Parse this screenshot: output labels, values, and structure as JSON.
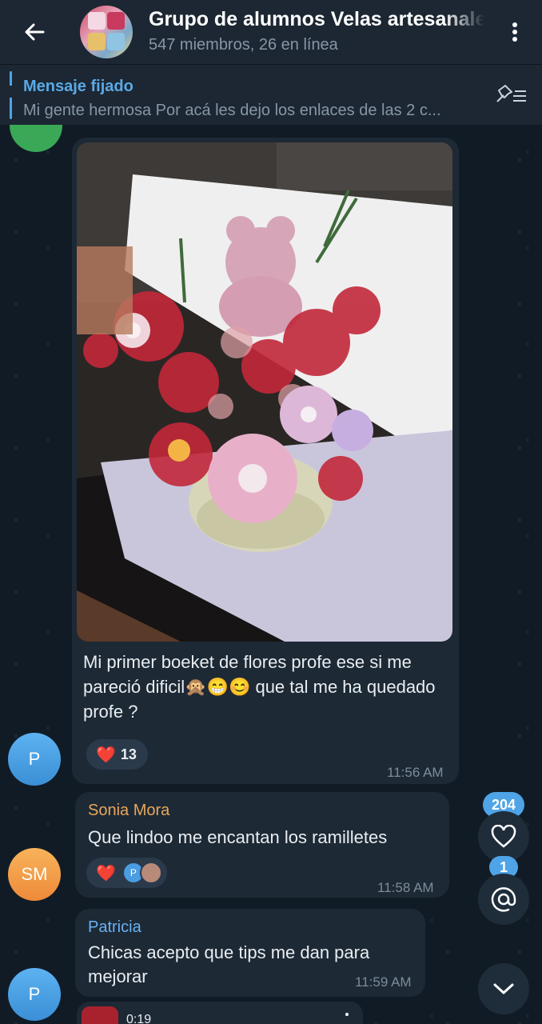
{
  "header": {
    "title": "Grupo de alumnos Velas artesanales",
    "subtitle": "547 miembros, 26 en línea"
  },
  "pinned": {
    "label": "Mensaje fijado",
    "text": "Mi gente hermosa Por acá les dejo los enlaces de las 2 c..."
  },
  "messages": [
    {
      "avatar_initial": "P",
      "caption": "Mi primer boeket de flores profe  ese si me pareció dificil🙊😁😊 que tal me ha quedado profe ?",
      "reaction": "❤️",
      "reaction_count": "13",
      "time": "11:56 AM"
    },
    {
      "sender": "Sonia Mora",
      "avatar_initial": "SM",
      "text": "Que lindoo me encantan los ramilletes",
      "reaction": "❤️",
      "reactor_initial": "P",
      "time": "11:58 AM"
    },
    {
      "sender": "Patricia",
      "avatar_initial": "P",
      "text": "Chicas acepto que tips me dan para mejorar",
      "time": "11:59 AM"
    }
  ],
  "next_message": {
    "duration": "0:19"
  },
  "floating": {
    "reactions_badge": "204",
    "mentions_badge": "1"
  },
  "colors": {
    "accent": "#4ea4e6",
    "sonia_name": "#e8a65a",
    "patricia_name": "#6ab2f2",
    "bubble": "#1d2935"
  }
}
